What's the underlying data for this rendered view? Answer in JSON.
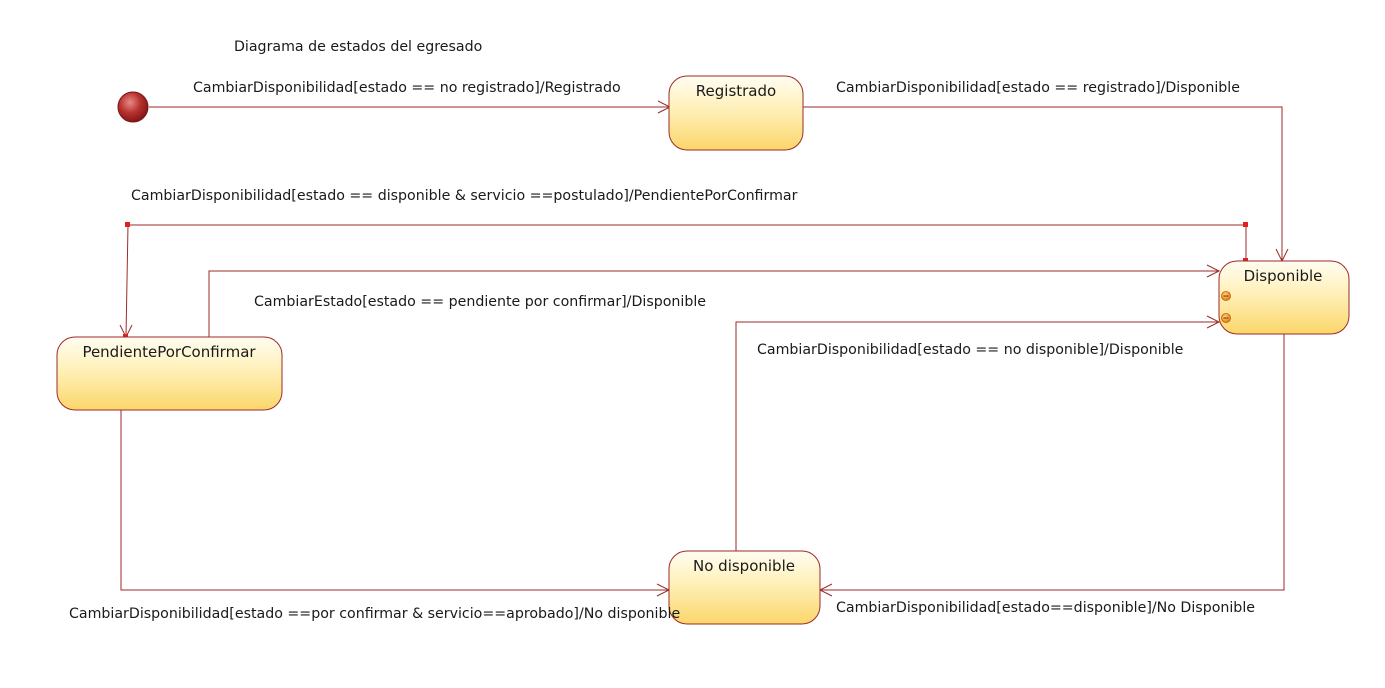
{
  "diagram": {
    "title": "Diagrama de estados del egresado",
    "states": {
      "registrado": "Registrado",
      "disponible": "Disponible",
      "pendiente": "PendientePorConfirmar",
      "no_disponible": "No disponible"
    },
    "transitions": {
      "initial_to_registrado": "CambiarDisponibilidad[estado == no registrado]/Registrado",
      "registrado_to_disponible": "CambiarDisponibilidad[estado == registrado]/Disponible",
      "disponible_to_pendiente": "CambiarDisponibilidad[estado == disponible & servicio ==postulado]/PendientePorConfirmar",
      "pendiente_to_disponible": "CambiarEstado[estado == pendiente por confirmar]/Disponible",
      "no_disponible_to_disponible": "CambiarDisponibilidad[estado == no disponible]/Disponible",
      "pendiente_to_no_disponible": "CambiarDisponibilidad[estado ==por confirmar & servicio==aprobado]/No disponible",
      "disponible_to_no_disponible": "CambiarDisponibilidad[estado==disponible]/No Disponible"
    },
    "colors": {
      "line": "#9e2a2a",
      "state_fill_top": "#fffbe8",
      "state_fill_bottom": "#fbd86a",
      "initial_node": "#a02020",
      "handle_dot": "#e02020"
    }
  }
}
